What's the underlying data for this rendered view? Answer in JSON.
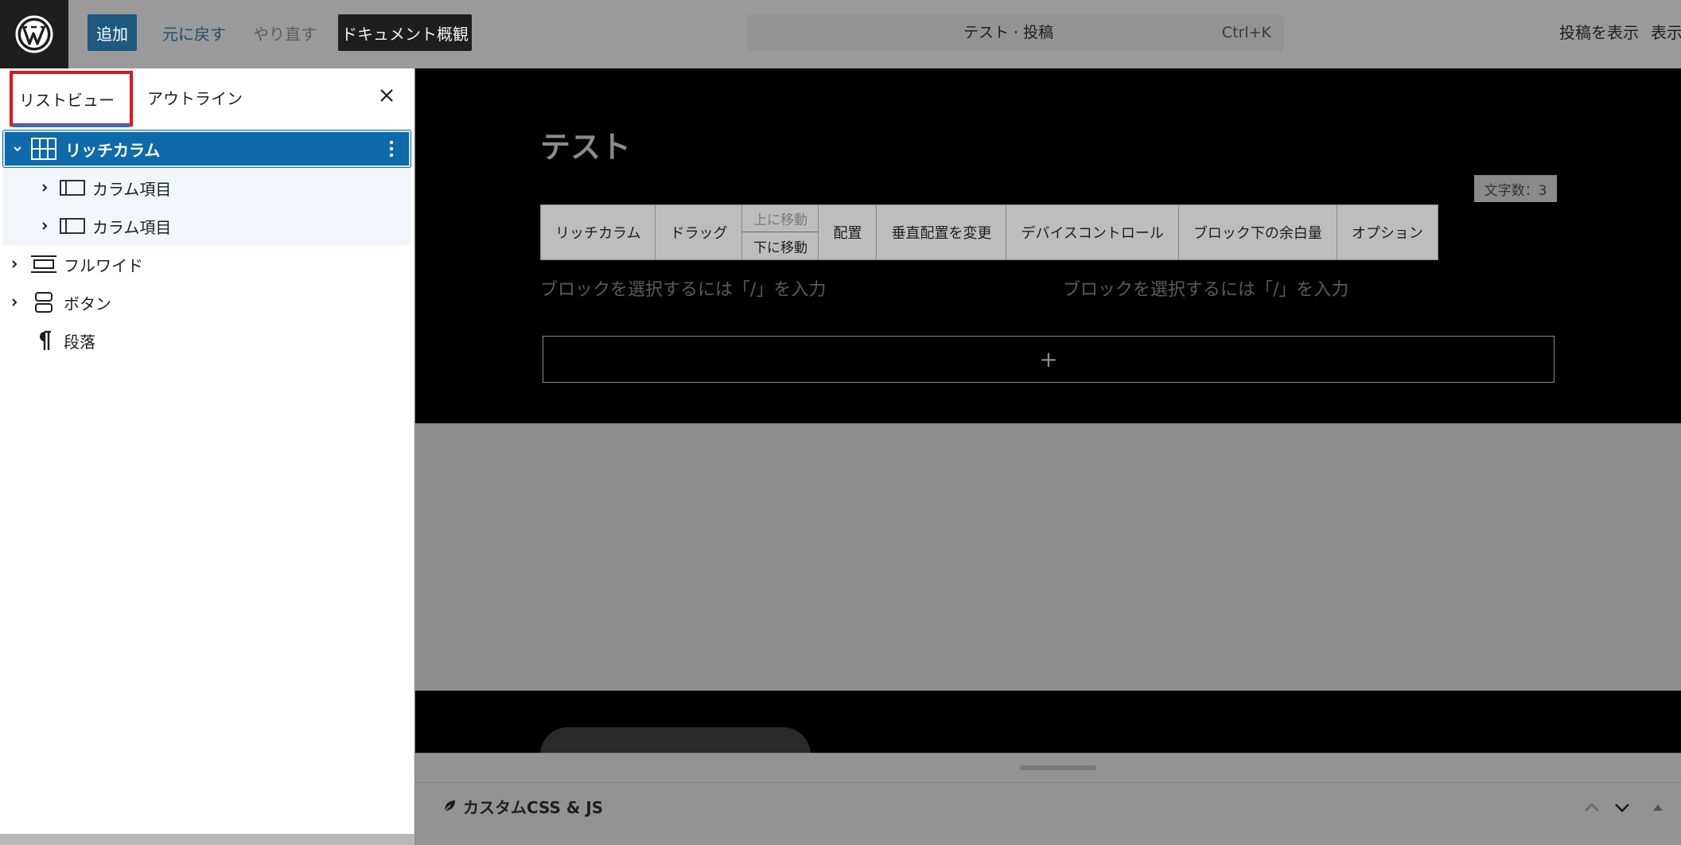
{
  "header": {
    "logo": "wordpress-logo",
    "add_label": "追加",
    "undo_label": "元に戻す",
    "redo_label": "やり直す",
    "document_overview_label": "ドキュメント概観",
    "command_bar": {
      "title": "テスト · 投稿",
      "shortcut": "Ctrl+K"
    },
    "view_post_label": "投稿を表示",
    "view_label": "表示"
  },
  "sidebar": {
    "tabs": [
      {
        "label": "リストビュー",
        "active": true
      },
      {
        "label": "アウトライン",
        "active": false
      }
    ],
    "close_icon": "close-icon",
    "tree": [
      {
        "label": "リッチカラム",
        "icon": "columns-icon",
        "expanded": true,
        "selected": true
      },
      {
        "label": "カラム項目",
        "icon": "column-icon",
        "expanded": false
      },
      {
        "label": "カラム項目",
        "icon": "column-icon",
        "expanded": false
      },
      {
        "label": "フルワイド",
        "icon": "full-width-icon",
        "expanded": false
      },
      {
        "label": "ボタン",
        "icon": "buttons-icon",
        "expanded": false
      },
      {
        "label": "段落",
        "icon": "paragraph-icon"
      }
    ]
  },
  "canvas": {
    "post_title": "テスト",
    "char_count": "文字数：3",
    "toolbar": {
      "block_name": "リッチカラム",
      "drag": "ドラッグ",
      "move_up": "上に移動",
      "move_down": "下に移動",
      "align": "配置",
      "vertical_align": "垂直配置を変更",
      "device_control": "デバイスコントロール",
      "block_margin": "ブロック下の余白量",
      "options": "オプション"
    },
    "placeholder_left": "ブロックを選択するには「/」を入力",
    "placeholder_right": "ブロックを選択するには「/」を入力",
    "append_symbol": "+"
  },
  "meta_panel": {
    "title": "カスタムCSS & JS"
  },
  "colors": {
    "accent": "#0e6aa8",
    "add_button": "#1e5a7d",
    "highlight_border": "#e3131b",
    "overlay_gray": "#8e8e8e"
  }
}
